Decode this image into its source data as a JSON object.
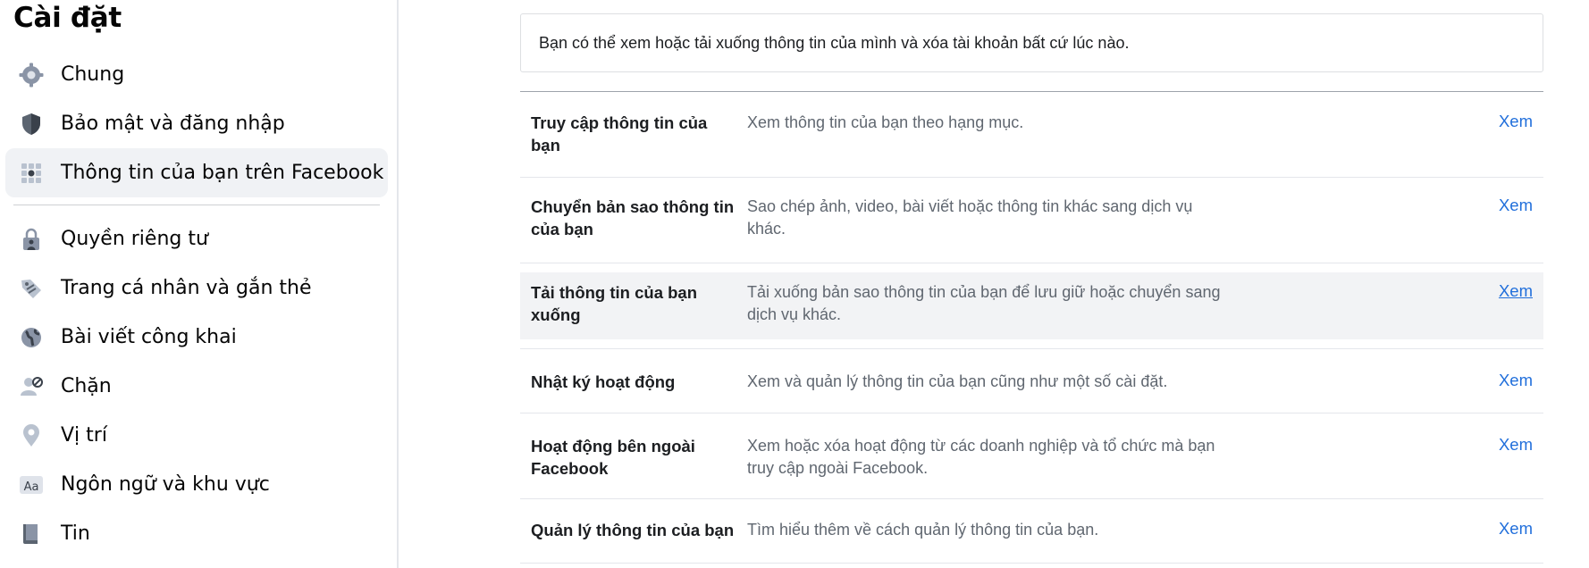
{
  "sidebar": {
    "title": "Cài đặt",
    "items": [
      {
        "label": "Chung",
        "icon": "gear-icon"
      },
      {
        "label": "Bảo mật và đăng nhập",
        "icon": "shield-icon"
      },
      {
        "label": "Thông tin của bạn trên Facebook",
        "icon": "grid-icon",
        "active": true
      },
      {
        "label": "Quyền riêng tư",
        "icon": "lock-icon"
      },
      {
        "label": "Trang cá nhân và gắn thẻ",
        "icon": "tag-icon"
      },
      {
        "label": "Bài viết công khai",
        "icon": "globe-icon"
      },
      {
        "label": "Chặn",
        "icon": "block-user-icon"
      },
      {
        "label": "Vị trí",
        "icon": "location-pin-icon"
      },
      {
        "label": "Ngôn ngữ và khu vực",
        "icon": "language-icon"
      },
      {
        "label": "Tin",
        "icon": "book-icon"
      }
    ]
  },
  "main": {
    "info": "Bạn có thể xem hoặc tải xuống thông tin của mình và xóa tài khoản bất cứ lúc nào.",
    "rows": [
      {
        "title": "Truy cập thông tin của bạn",
        "desc": "Xem thông tin của bạn theo hạng mục.",
        "link": "Xem"
      },
      {
        "title": "Chuyển bản sao thông tin của bạn",
        "desc": "Sao chép ảnh, video, bài viết hoặc thông tin khác sang dịch vụ khác.",
        "link": "Xem"
      },
      {
        "title": "Tải thông tin của bạn xuống",
        "desc": "Tải xuống bản sao thông tin của bạn để lưu giữ hoặc chuyển sang dịch vụ khác.",
        "link": "Xem"
      },
      {
        "title": "Nhật ký hoạt động",
        "desc": "Xem và quản lý thông tin của bạn cũng như một số cài đặt.",
        "link": "Xem"
      },
      {
        "title": "Hoạt động bên ngoài Facebook",
        "desc": "Xem hoặc xóa hoạt động từ các doanh nghiệp và tổ chức mà bạn truy cập ngoài Facebook.",
        "link": "Xem"
      },
      {
        "title": "Quản lý thông tin của bạn",
        "desc": "Tìm hiểu thêm về cách quản lý thông tin của bạn.",
        "link": "Xem"
      }
    ]
  },
  "colors": {
    "link": "#216fdb",
    "active_bg": "#f0f2f5",
    "icon": "#606770"
  }
}
